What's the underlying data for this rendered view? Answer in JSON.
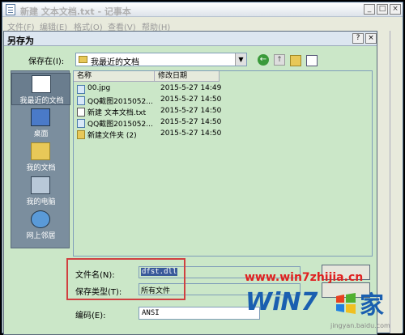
{
  "notepad": {
    "title": "新建 文本文档.txt - 记事本",
    "menu": [
      "文件(F)",
      "编辑(E)",
      "格式(O)",
      "查看(V)",
      "帮助(H)"
    ]
  },
  "dialog": {
    "title": "另存为",
    "help": "?",
    "close": "×",
    "save_in_label": "保存在(I):",
    "save_in_value": "我最近的文档",
    "places": [
      "我最近的文档",
      "桌面",
      "我的文档",
      "我的电脑",
      "网上邻居"
    ],
    "columns": [
      "名称",
      "修改日期"
    ],
    "files": [
      {
        "name": "00.jpg",
        "date": "2015-5-27 14:49",
        "icon": "image-icon"
      },
      {
        "name": "QQ截图2015052...",
        "date": "2015-5-27 14:50",
        "icon": "image-icon"
      },
      {
        "name": "新建 文本文档.txt",
        "date": "2015-5-27 14:50",
        "icon": "text-file-icon"
      },
      {
        "name": "QQ截图2015052...",
        "date": "2015-5-27 14:50",
        "icon": "image-icon"
      },
      {
        "name": "新建文件夹 (2)",
        "date": "2015-5-27 14:50",
        "icon": "folder-icon"
      }
    ],
    "filename_label": "文件名(N):",
    "filename_value": "dfst.dll",
    "filetype_label": "保存类型(T):",
    "filetype_value": "所有文件",
    "encoding_label": "编码(E):",
    "encoding_value": "ANSI"
  },
  "watermark": {
    "url": "www.win7zhijia.cn",
    "brand": "WiN7",
    "brand_cjk": "家",
    "sub": "jingyan.baidu.com"
  },
  "colors": {
    "dialog_bg": "#cbe7c8",
    "highlight_box": "#d04040",
    "selection": "#3a5a9a"
  }
}
